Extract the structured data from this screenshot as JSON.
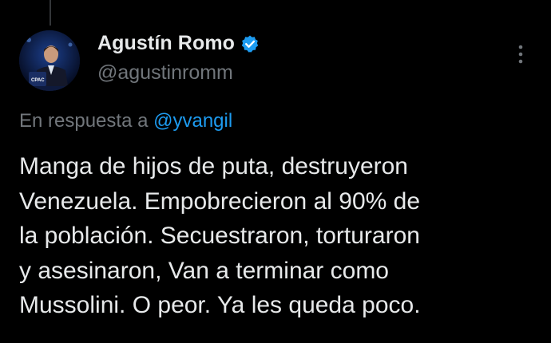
{
  "author": {
    "display_name": "Agustín Romo",
    "handle": "@agustinromm",
    "verified_icon": "verified-badge-icon",
    "avatar_accent": "#1d9bf0"
  },
  "reply": {
    "prefix": "En respuesta a",
    "mention": "@yvangil"
  },
  "tweet": {
    "lines": [
      "Manga de hijos de puta, destruyeron",
      "Venezuela. Empobrecieron al 90% de",
      "la población. Secuestraron, torturaron",
      "y asesinaron, Van a terminar como",
      "Mussolini. O peor. Ya les queda poco."
    ]
  },
  "menu": {
    "icon": "more-vertical-icon"
  },
  "colors": {
    "background": "#000000",
    "text": "#e7e9ea",
    "muted": "#71767b",
    "accent": "#1d9bf0"
  }
}
